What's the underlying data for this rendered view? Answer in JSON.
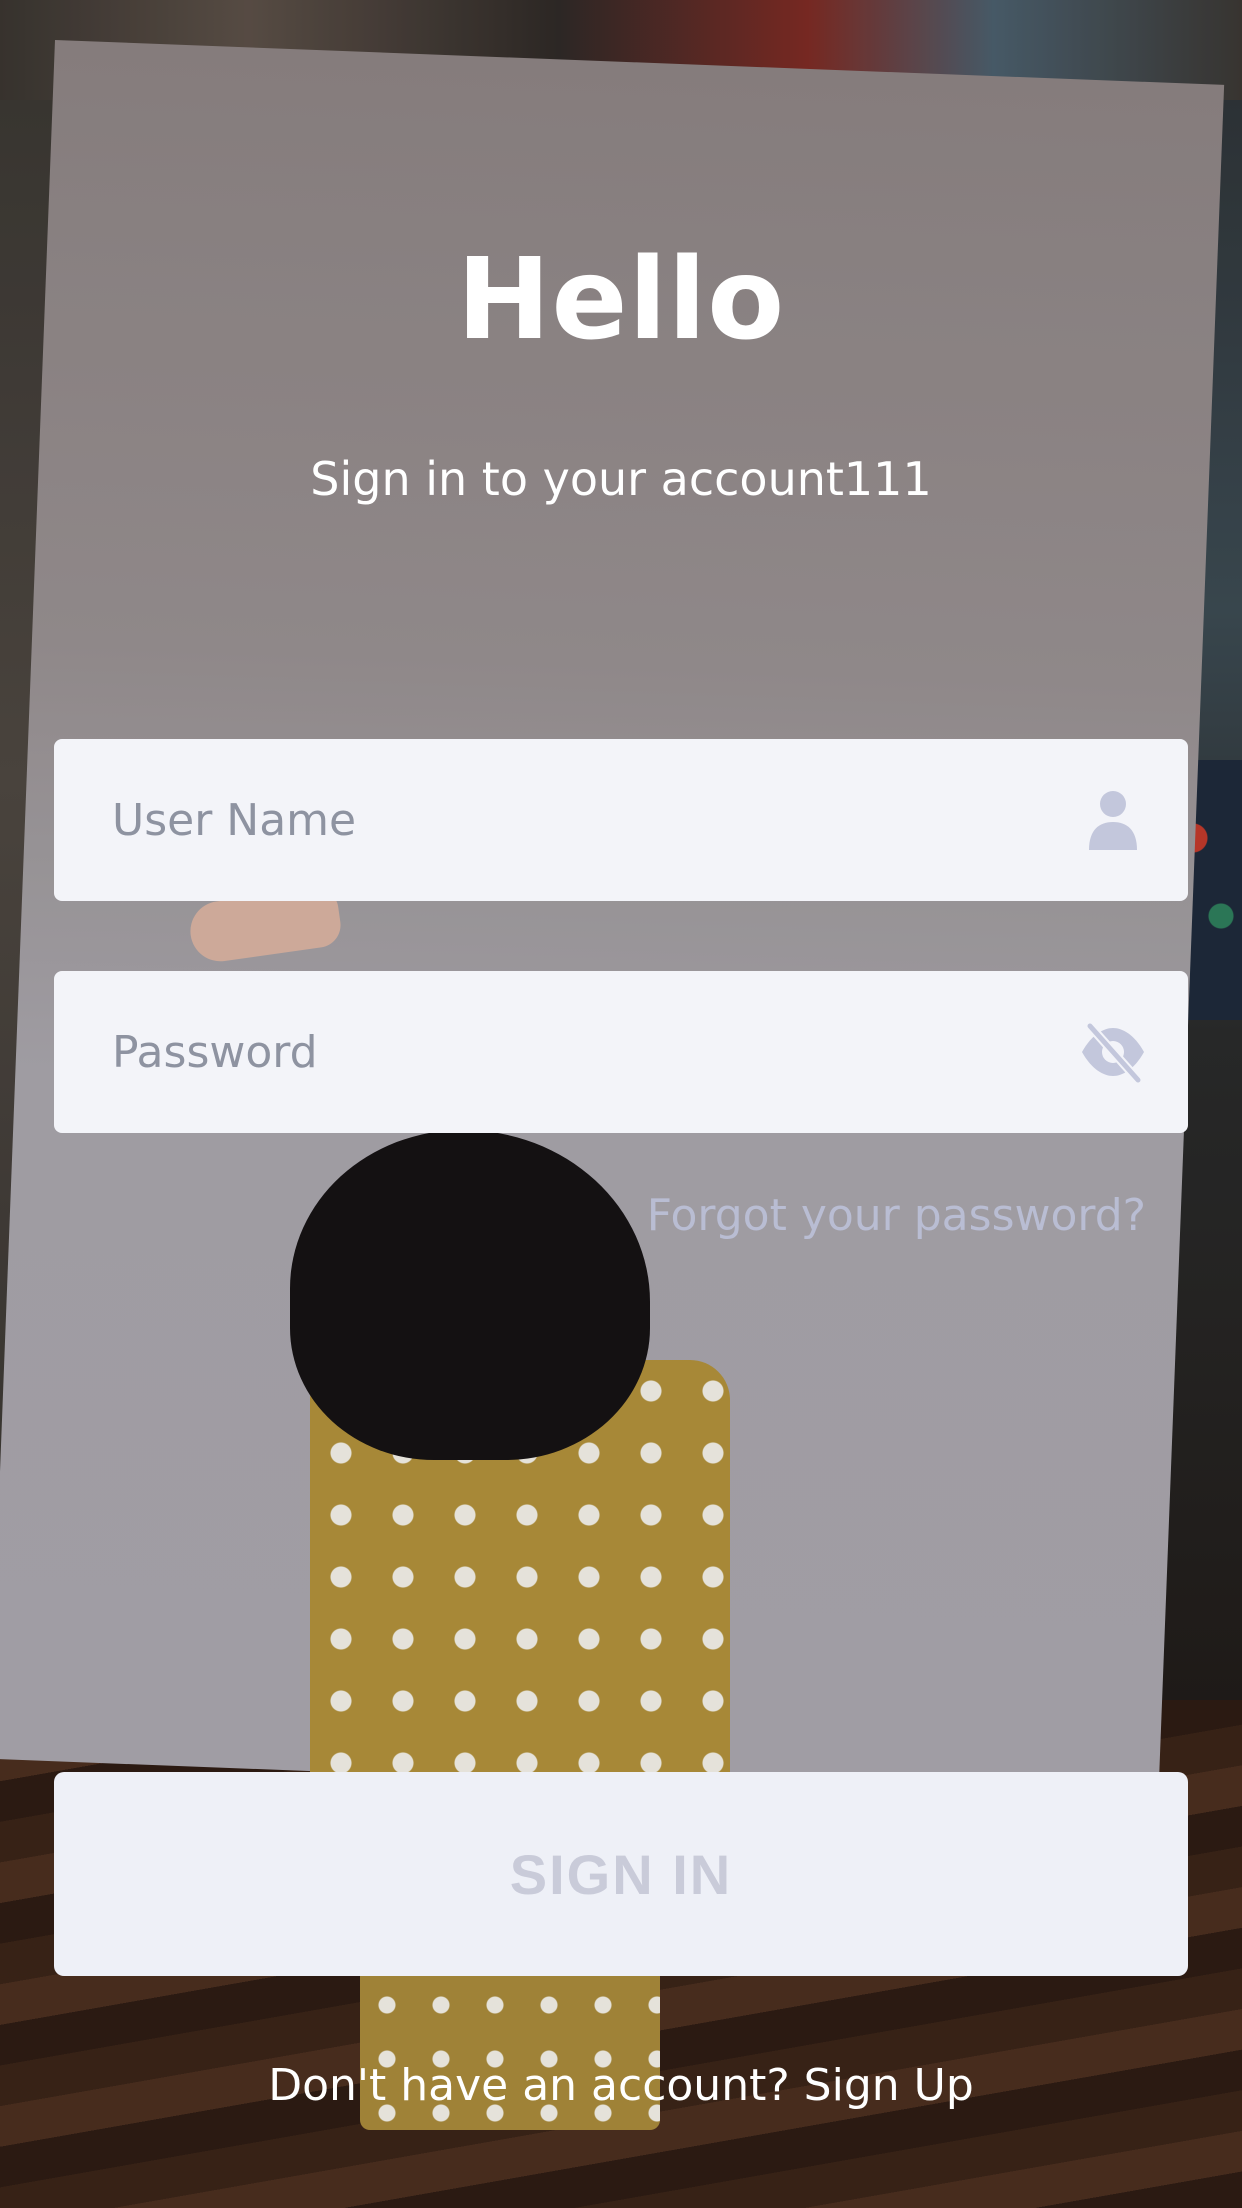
{
  "header": {
    "title": "Hello",
    "subtitle": "Sign in to your account111"
  },
  "form": {
    "username": {
      "value": "",
      "placeholder": "User Name",
      "icon": "user-icon"
    },
    "password": {
      "value": "",
      "placeholder": "Password",
      "icon": "eye-off-icon"
    },
    "forgot_label": "Forgot your password?",
    "submit_label": "SIGN IN"
  },
  "footer": {
    "signup_text": "Don't have an account? Sign Up"
  },
  "colors": {
    "field_bg": "#f3f4f9",
    "icon": "#c3c7dc",
    "link": "#b9bdd3",
    "button_bg": "#eef0f7",
    "button_text": "#c9cbd9",
    "text_light": "#ffffff"
  }
}
